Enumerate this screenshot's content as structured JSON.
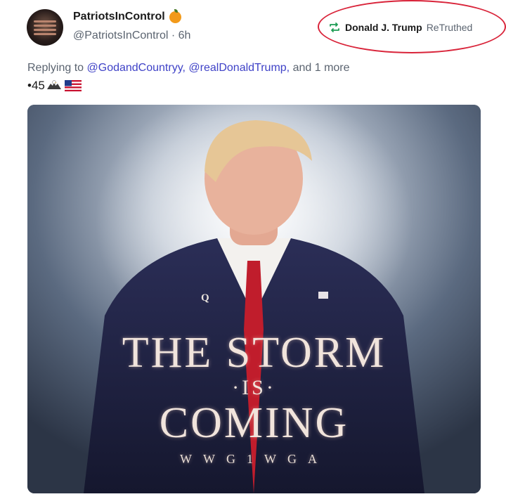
{
  "post": {
    "display_name": "PatriotsInControl",
    "badge_icon": "orange-badge-icon",
    "handle": "@PatriotsInControl",
    "separator": "·",
    "time_ago": "6h",
    "retruth": {
      "icon": "retruth-icon",
      "name": "Donald J. Trump",
      "label": "ReTruthed",
      "annotation_color": "#d9243a"
    },
    "reply": {
      "prefix": "Replying to",
      "mention_1": "@GodandCountryy,",
      "mention_2": "@realDonaldTrump,",
      "suffix": "and 1 more"
    },
    "body_text": "•45",
    "body_icons": [
      "eagle-icon",
      "us-flag-icon"
    ],
    "media": {
      "title_line_1": "THE STORM",
      "title_line_2": "·IS·",
      "title_line_3": "COMING",
      "tagline": "WWG1WGA",
      "lapel_pin": "Q"
    },
    "colors": {
      "mention": "#3f42c7",
      "muted": "#5b6470"
    }
  }
}
